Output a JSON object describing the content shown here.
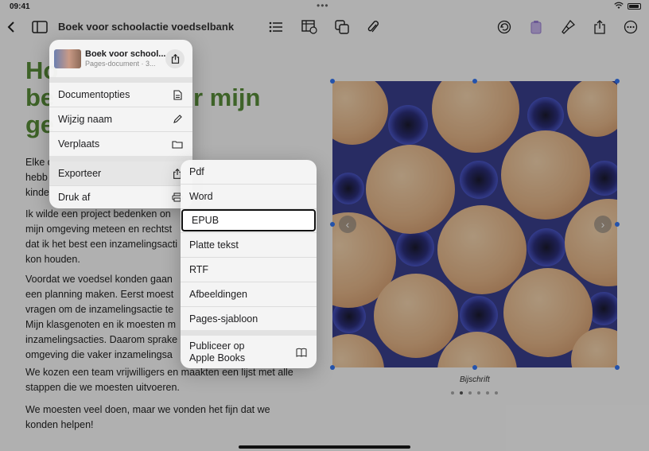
{
  "status": {
    "time": "09:41",
    "dots": "•••"
  },
  "toolbar": {
    "title": "Boek voor schoolactie voedselbank",
    "icons": [
      "back-icon",
      "sidebar-icon",
      "list-icon",
      "table-insert-icon",
      "shapes-icon",
      "paperclip-icon",
      "undo-icon",
      "format-icon",
      "paintbrush-icon",
      "share-icon",
      "more-icon"
    ]
  },
  "document": {
    "heading_lines": [
      "Ho",
      "be",
      "ge"
    ],
    "heading_right": "r mijn",
    "paragraphs": [
      [
        "Elke d",
        "hebb",
        "kinde"
      ],
      [
        "Ik wilde een project bedenken on",
        "mijn omgeving meteen en rechtst",
        "dat ik het best een inzamelingsacti",
        "kon houden."
      ],
      [
        "Voordat we voedsel konden gaan",
        "een planning maken. Eerst moest",
        "vragen om de inzamelingsactie te",
        "Mijn klasgenoten en ik moesten m",
        "inzamelingsacties. Daarom sprake",
        "omgeving die vaker inzamelingsa"
      ],
      [
        "We kozen een team vrijwilligers en maakten een lijst met alle",
        "stappen die we moesten uitvoeren."
      ],
      [
        "We moesten veel doen, maar we vonden het fijn dat we",
        "konden helpen!"
      ]
    ],
    "caption": "Bijschrift"
  },
  "menu": {
    "doc_name": "Boek voor school...",
    "doc_type": "Pages-document · 3...",
    "items": [
      "Documentopties",
      "Wijzig naam",
      "Verplaats",
      "Exporteer",
      "Druk af"
    ]
  },
  "export_menu": {
    "items": [
      "Pdf",
      "Word",
      "EPUB",
      "Platte tekst",
      "RTF",
      "Afbeeldingen",
      "Pages-sjabloon"
    ],
    "publish_line1": "Publiceer op",
    "publish_line2": "Apple Books",
    "selected": "EPUB"
  }
}
